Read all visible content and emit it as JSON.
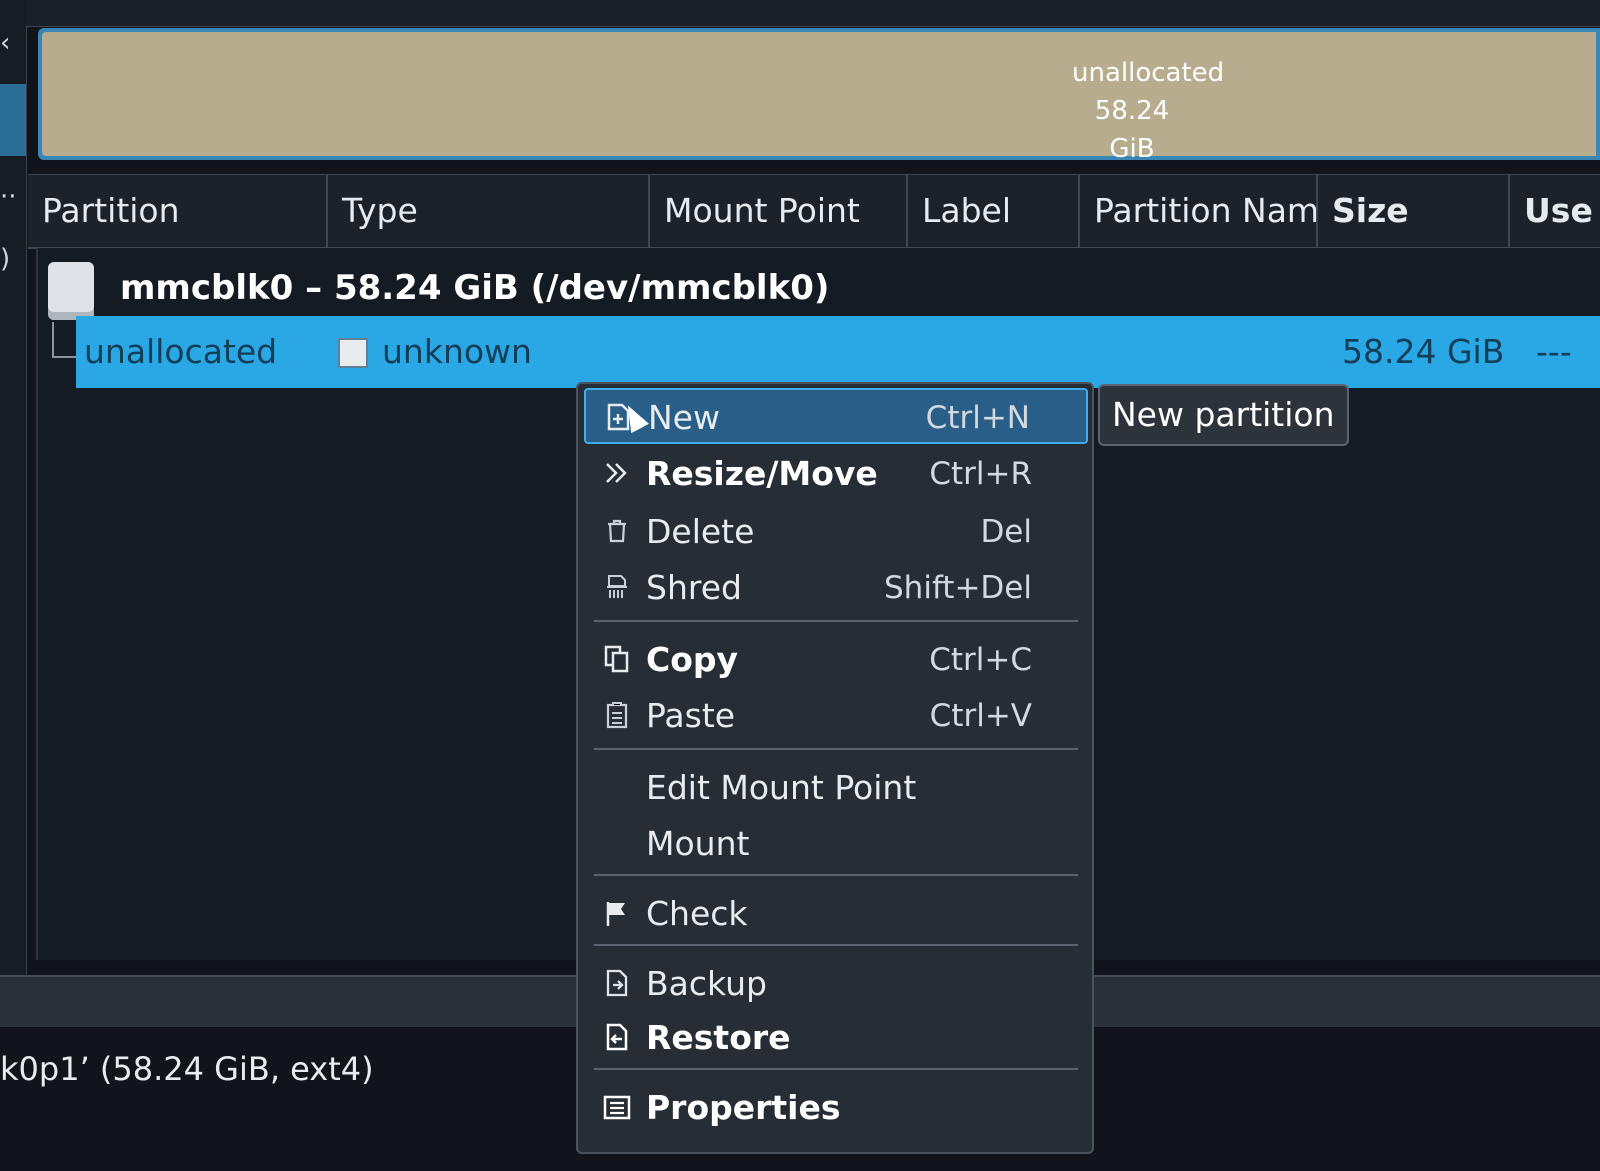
{
  "disk_bar": {
    "label_line1": "unallocated",
    "label_line2": "58.24 GiB",
    "fill_color": "#b8ac8e",
    "border_color": "#3a87b5"
  },
  "columns": [
    "Partition",
    "Type",
    "Mount Point",
    "Label",
    "Partition Nam",
    "Size",
    "Use"
  ],
  "device": {
    "title": "mmcblk0 – 58.24 GiB (/dev/mmcblk0)",
    "icon": "drive-icon"
  },
  "partition_row": {
    "partition": "unallocated",
    "type": "unknown",
    "size": "58.24 GiB",
    "used": "---",
    "highlight_color": "#2aa7e5"
  },
  "context_menu": {
    "items": [
      {
        "label": "New",
        "shortcut": "Ctrl+N",
        "icon": "new-partition-icon"
      },
      {
        "label": "Resize/Move",
        "shortcut": "Ctrl+R",
        "icon": "resize-icon"
      },
      {
        "label": "Delete",
        "shortcut": "Del",
        "icon": "trash-icon"
      },
      {
        "label": "Shred",
        "shortcut": "Shift+Del",
        "icon": "shred-icon"
      },
      {
        "label": "Copy",
        "shortcut": "Ctrl+C",
        "icon": "copy-icon"
      },
      {
        "label": "Paste",
        "shortcut": "Ctrl+V",
        "icon": "paste-icon"
      },
      {
        "label": "Edit Mount Point",
        "shortcut": "",
        "icon": ""
      },
      {
        "label": "Mount",
        "shortcut": "",
        "icon": ""
      },
      {
        "label": "Check",
        "shortcut": "",
        "icon": "flag-icon"
      },
      {
        "label": "Backup",
        "shortcut": "",
        "icon": "backup-icon"
      },
      {
        "label": "Restore",
        "shortcut": "",
        "icon": "restore-icon"
      },
      {
        "label": "Properties",
        "shortcut": "",
        "icon": "properties-icon"
      }
    ],
    "highlighted": "New"
  },
  "tooltip": "New partition",
  "status_text": "k0p1’ (58.24 GiB, ext4)",
  "left_glyphs": [
    "‹",
    "··",
    ")"
  ]
}
